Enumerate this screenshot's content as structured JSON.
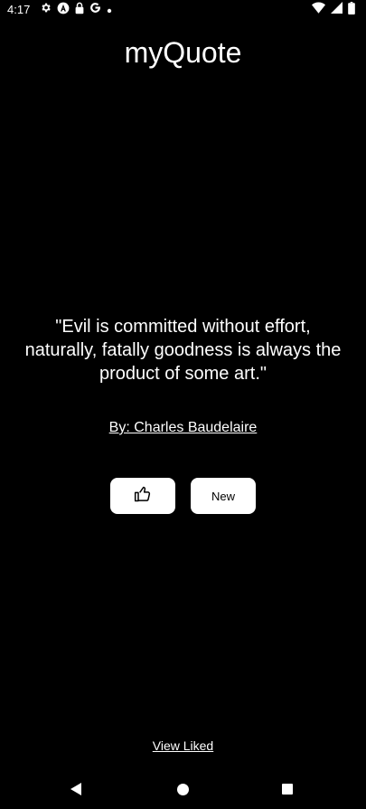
{
  "status_bar": {
    "time": "4:17",
    "left_icons": [
      "gear-icon",
      "a-circle-icon",
      "lock-icon",
      "google-icon",
      "dot-icon"
    ],
    "right_icons": [
      "wifi-icon",
      "signal-icon",
      "battery-icon"
    ]
  },
  "app": {
    "title": "myQuote"
  },
  "quote": {
    "text": "\"Evil is committed without effort, naturally, fatally goodness is always the product of some art.\"",
    "author": "By: Charles Baudelaire"
  },
  "actions": {
    "like_icon": "thumbs-up-icon",
    "new_label": "New"
  },
  "footer": {
    "view_liked_label": "View Liked"
  },
  "nav": {
    "icons": [
      "back-icon",
      "home-icon",
      "recents-icon"
    ]
  }
}
